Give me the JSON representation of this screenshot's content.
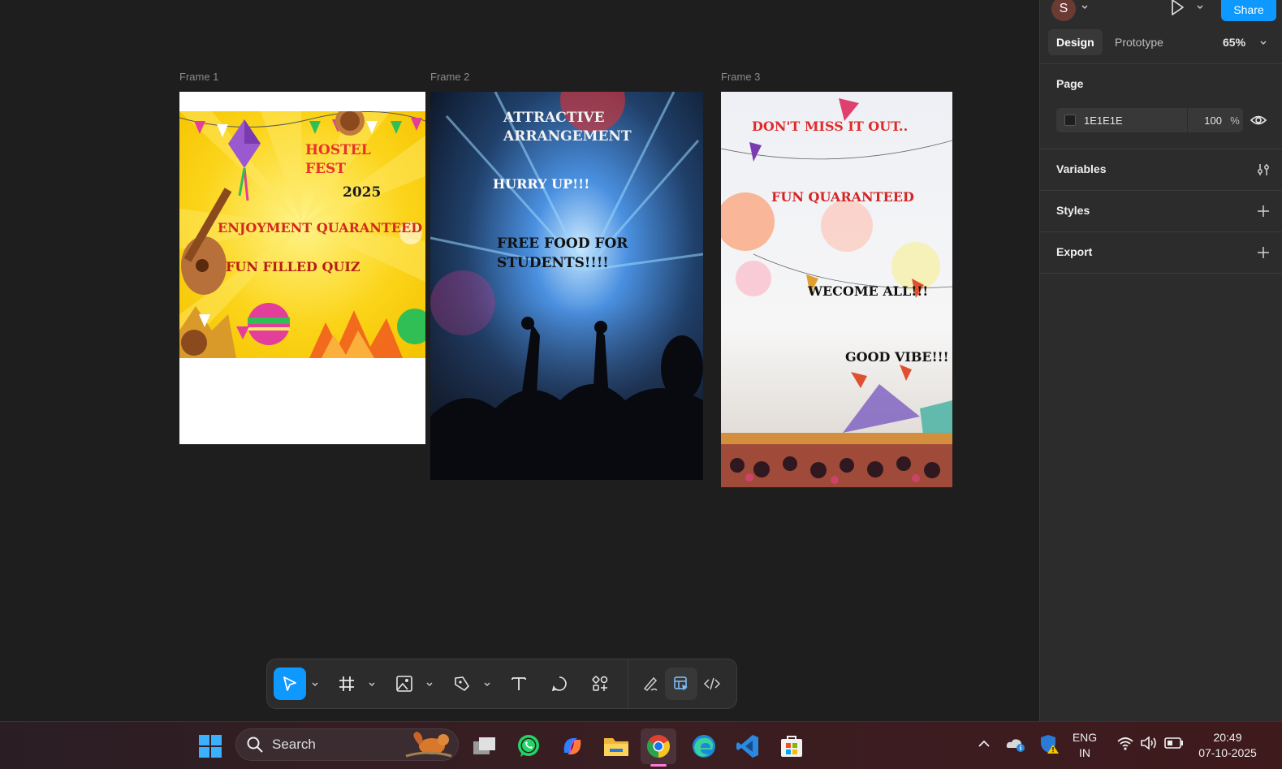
{
  "canvas": {
    "frames": [
      {
        "label": "Frame 1"
      },
      {
        "label": "Frame 2"
      },
      {
        "label": "Frame 3"
      }
    ],
    "poster1": {
      "title_line1": "HOSTEL",
      "title_line2": "FEST",
      "year": "2025",
      "line3": "ENJOYMENT QUARANTEED",
      "line4": "FUN FILLED QUIZ"
    },
    "poster2": {
      "line1": "ATTRACTIVE",
      "line2": "ARRANGEMENT",
      "line3": "HURRY UP!!!",
      "line4": "FREE FOOD FOR",
      "line5": "STUDENTS!!!!"
    },
    "poster3": {
      "line1": "DON'T MISS IT OUT..",
      "line2": "FUN QUARANTEED",
      "line3": "WECOME ALL!!!",
      "line4": "GOOD VIBE!!!"
    }
  },
  "panel": {
    "avatar_initial": "S",
    "share_label": "Share",
    "tabs": [
      {
        "label": "Design",
        "active": true
      },
      {
        "label": "Prototype",
        "active": false
      }
    ],
    "zoom": "65%",
    "page": {
      "title": "Page",
      "fill_hex": "1E1E1E",
      "opacity": "100",
      "percent_sign": "%"
    },
    "sections": [
      {
        "title": "Variables",
        "icon": "sliders-icon"
      },
      {
        "title": "Styles",
        "icon": "plus-icon"
      },
      {
        "title": "Export",
        "icon": "plus-icon"
      }
    ],
    "help_label": "?"
  },
  "toolbar": {
    "tools": [
      "move-tool",
      "frame-tool",
      "image-tool",
      "pen-tool",
      "text-tool",
      "comment-tool",
      "actions-tool",
      "draw-mode",
      "design-mode",
      "dev-mode"
    ]
  },
  "taskbar": {
    "search_label": "Search",
    "lang_line1": "ENG",
    "lang_line2": "IN",
    "time": "20:49",
    "date": "07-10-2025"
  },
  "colors": {
    "canvas_bg": "#1e1e1e",
    "panel_bg": "#2c2c2c",
    "accent": "#0d99ff"
  }
}
